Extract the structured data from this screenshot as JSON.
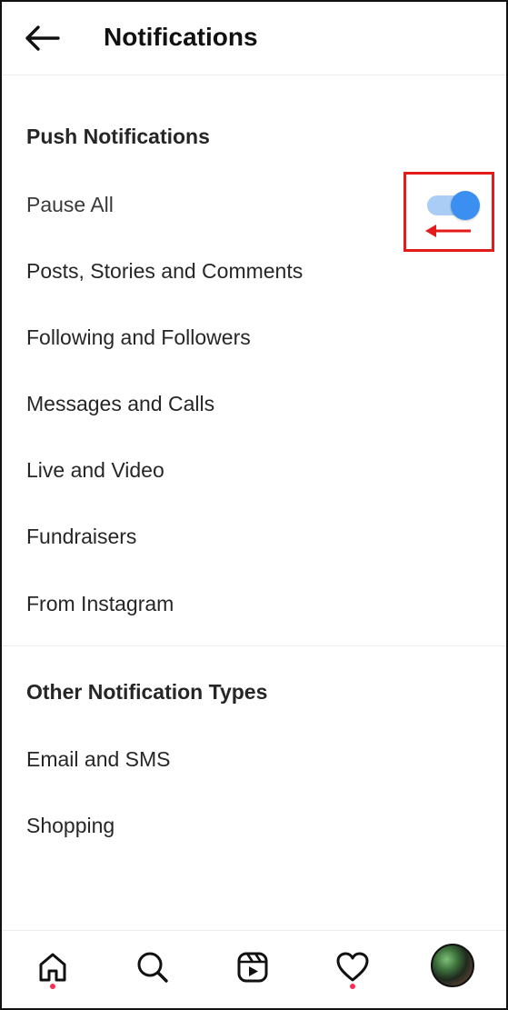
{
  "header": {
    "back_icon": "arrow-left-icon",
    "title": "Notifications"
  },
  "push_notifications": {
    "title": "Push Notifications",
    "pause_all": {
      "label": "Pause All",
      "toggle_on": true,
      "toggle_color": "#3a8ff0"
    },
    "items": [
      {
        "label": "Posts, Stories and Comments"
      },
      {
        "label": "Following and Followers"
      },
      {
        "label": "Messages and Calls"
      },
      {
        "label": "Live and Video"
      },
      {
        "label": "Fundraisers"
      },
      {
        "label": "From Instagram"
      }
    ]
  },
  "other_notifications": {
    "title": "Other Notification Types",
    "items": [
      {
        "label": "Email and SMS"
      },
      {
        "label": "Shopping"
      }
    ]
  },
  "annotation": {
    "color": "#e31b1b",
    "arrow_direction": "left"
  },
  "bottom_nav": {
    "items": [
      {
        "icon": "home-icon",
        "has_dot": true
      },
      {
        "icon": "search-icon",
        "has_dot": false
      },
      {
        "icon": "reels-icon",
        "has_dot": false
      },
      {
        "icon": "heart-icon",
        "has_dot": true
      },
      {
        "icon": "profile-avatar",
        "has_dot": false
      }
    ],
    "dot_color": "#ff2d55"
  }
}
